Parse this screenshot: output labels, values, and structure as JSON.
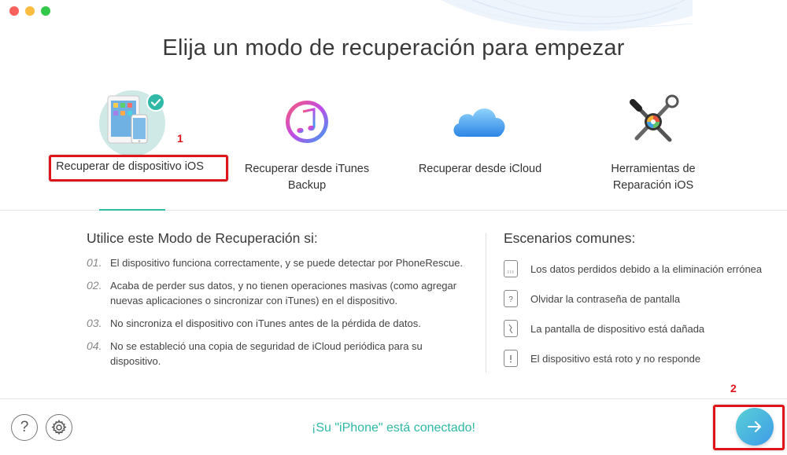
{
  "window": {
    "title": "Elija un modo de recuperación para empezar",
    "traffic_colors": [
      "#fc605c",
      "#fdbc40",
      "#34c84a"
    ]
  },
  "modes": [
    {
      "label_line1": "Recuperar de dispositivo iOS",
      "label_line2": "",
      "selected": true,
      "icon": "ios-devices-icon"
    },
    {
      "label_line1": "Recuperar desde iTunes",
      "label_line2": "Backup",
      "selected": false,
      "icon": "itunes-icon"
    },
    {
      "label_line1": "Recuperar desde iCloud",
      "label_line2": "",
      "selected": false,
      "icon": "icloud-icon"
    },
    {
      "label_line1": "Herramientas de",
      "label_line2": "Reparación iOS",
      "selected": false,
      "icon": "repair-tools-icon"
    }
  ],
  "annotations": {
    "step1": "1",
    "step2": "2"
  },
  "usage": {
    "title": "Utilice este Modo de Recuperación si:",
    "items": [
      {
        "num": "01.",
        "text": "El dispositivo funciona correctamente, y se puede detectar por PhoneRescue."
      },
      {
        "num": "02.",
        "text": "Acaba de perder sus datos, y no tienen operaciones masivas (como agregar nuevas aplicaciones o sincronizar con iTunes) en el dispositivo."
      },
      {
        "num": "03.",
        "text": "No sincroniza el dispositivo con iTunes antes de la pérdida de datos."
      },
      {
        "num": "04.",
        "text": "No se estableció una copia de seguridad de iCloud periódica para su dispositivo."
      }
    ]
  },
  "scenarios": {
    "title": "Escenarios comunes:",
    "items": [
      {
        "text": "Los datos perdidos debido a la eliminación errónea",
        "icon": "deleted-data-icon"
      },
      {
        "text": "Olvidar la contraseña de pantalla",
        "icon": "forgot-passcode-icon"
      },
      {
        "text": "La pantalla de dispositivo está dañada",
        "icon": "broken-screen-icon"
      },
      {
        "text": "El dispositivo está roto y no responde",
        "icon": "unresponsive-device-icon"
      }
    ]
  },
  "footer": {
    "help_glyph": "?",
    "status": "¡Su \"iPhone\" está conectado!",
    "accent_color": "#2fb9a6"
  }
}
